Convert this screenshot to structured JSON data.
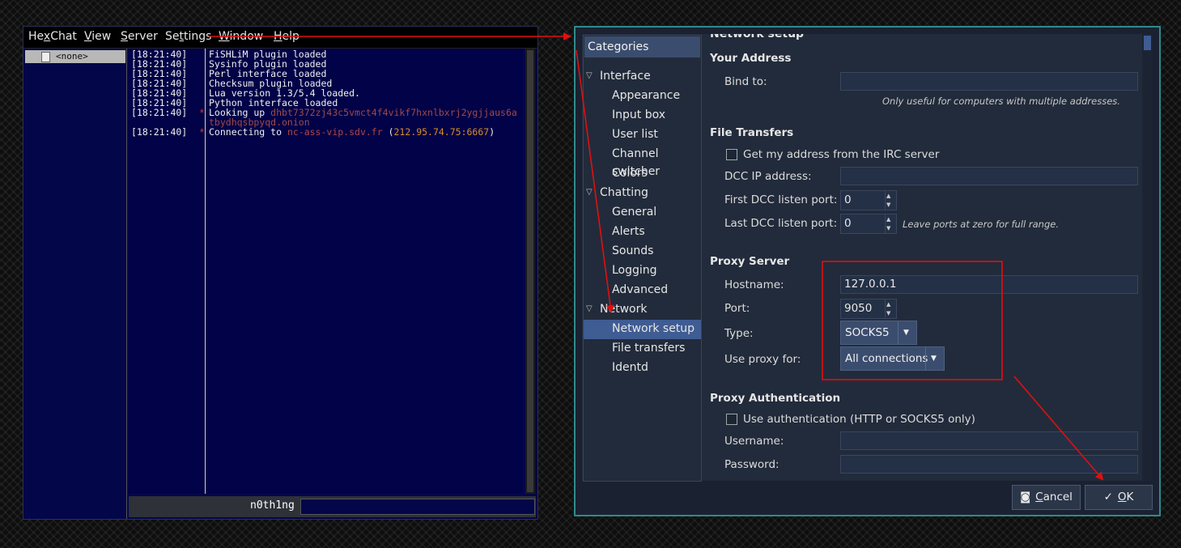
{
  "hexchat": {
    "menu": [
      {
        "label": "HexChat",
        "mnemonic": "x"
      },
      {
        "label": "View",
        "mnemonic": "V"
      },
      {
        "label": "Server",
        "mnemonic": "S"
      },
      {
        "label": "Settings",
        "mnemonic": "t"
      },
      {
        "label": "Window",
        "mnemonic": "W"
      },
      {
        "label": "Help",
        "mnemonic": "H"
      }
    ],
    "channel": "<none>",
    "log": [
      {
        "ts": "[18:21:40]",
        "nick": "",
        "msg": "FiSHLiM plugin loaded"
      },
      {
        "ts": "[18:21:40]",
        "nick": "",
        "msg": "Sysinfo plugin loaded"
      },
      {
        "ts": "[18:21:40]",
        "nick": "",
        "msg": "Perl interface loaded"
      },
      {
        "ts": "[18:21:40]",
        "nick": "",
        "msg": "Checksum plugin loaded"
      },
      {
        "ts": "[18:21:40]",
        "nick": "",
        "msg": "Lua version 1.3/5.4 loaded."
      },
      {
        "ts": "[18:21:40]",
        "nick": "",
        "msg": "Python interface loaded"
      }
    ],
    "lookup": {
      "ts": "[18:21:40]",
      "nick": "*",
      "prefix": "Looking up ",
      "host_line1": "dhbt7372zj43c5vmct4f4vikf7hxnlbxrj2ygjjaus6a",
      "host_line2": "tbydhqsbpyqd.onion"
    },
    "connect": {
      "ts": "[18:21:40]",
      "nick": "*",
      "prefix": "Connecting to ",
      "host": "nc-ass-vip.sdv.fr",
      "open": " (",
      "ip": "212.95.74.75:6667",
      "close": ")"
    },
    "nickname": "n0th1ng"
  },
  "prefs": {
    "categories_header": "Categories",
    "categories": [
      {
        "label": "Interface",
        "level": 0,
        "expanded": true
      },
      {
        "label": "Appearance",
        "level": 1
      },
      {
        "label": "Input box",
        "level": 1
      },
      {
        "label": "User list",
        "level": 1
      },
      {
        "label": "Channel switcher",
        "level": 1
      },
      {
        "label": "Colors",
        "level": 1
      },
      {
        "label": "Chatting",
        "level": 0,
        "expanded": true
      },
      {
        "label": "General",
        "level": 1
      },
      {
        "label": "Alerts",
        "level": 1
      },
      {
        "label": "Sounds",
        "level": 1
      },
      {
        "label": "Logging",
        "level": 1
      },
      {
        "label": "Advanced",
        "level": 1
      },
      {
        "label": "Network",
        "level": 0,
        "expanded": true
      },
      {
        "label": "Network setup",
        "level": 1,
        "selected": true
      },
      {
        "label": "File transfers",
        "level": 1
      },
      {
        "label": "Identd",
        "level": 1
      }
    ],
    "title": "Network setup",
    "your_address": {
      "heading": "Your Address",
      "bind_label": "Bind to:",
      "bind_value": "",
      "hint": "Only useful for computers with multiple addresses."
    },
    "file_transfers": {
      "heading": "File Transfers",
      "get_addr_label": "Get my address from the IRC server",
      "dcc_ip_label": "DCC IP address:",
      "dcc_ip_value": "",
      "first_port_label": "First DCC listen port:",
      "first_port_value": "0",
      "last_port_label": "Last DCC listen port:",
      "last_port_value": "0",
      "ports_hint": "Leave ports at zero for full range."
    },
    "proxy": {
      "heading": "Proxy Server",
      "hostname_label": "Hostname:",
      "hostname_value": "127.0.0.1",
      "port_label": "Port:",
      "port_value": "9050",
      "type_label": "Type:",
      "type_value": "SOCKS5",
      "use_for_label": "Use proxy for:",
      "use_for_value": "All connections"
    },
    "proxy_auth": {
      "heading": "Proxy Authentication",
      "use_auth_label": "Use authentication (HTTP or SOCKS5 only)",
      "username_label": "Username:",
      "username_value": "",
      "password_label": "Password:",
      "password_value": ""
    },
    "buttons": {
      "cancel": "Cancel",
      "ok": "OK"
    }
  },
  "colors": {
    "annotation": "#e01010",
    "selection": "#3f5c93",
    "dialog_border": "#2f8a8c"
  }
}
